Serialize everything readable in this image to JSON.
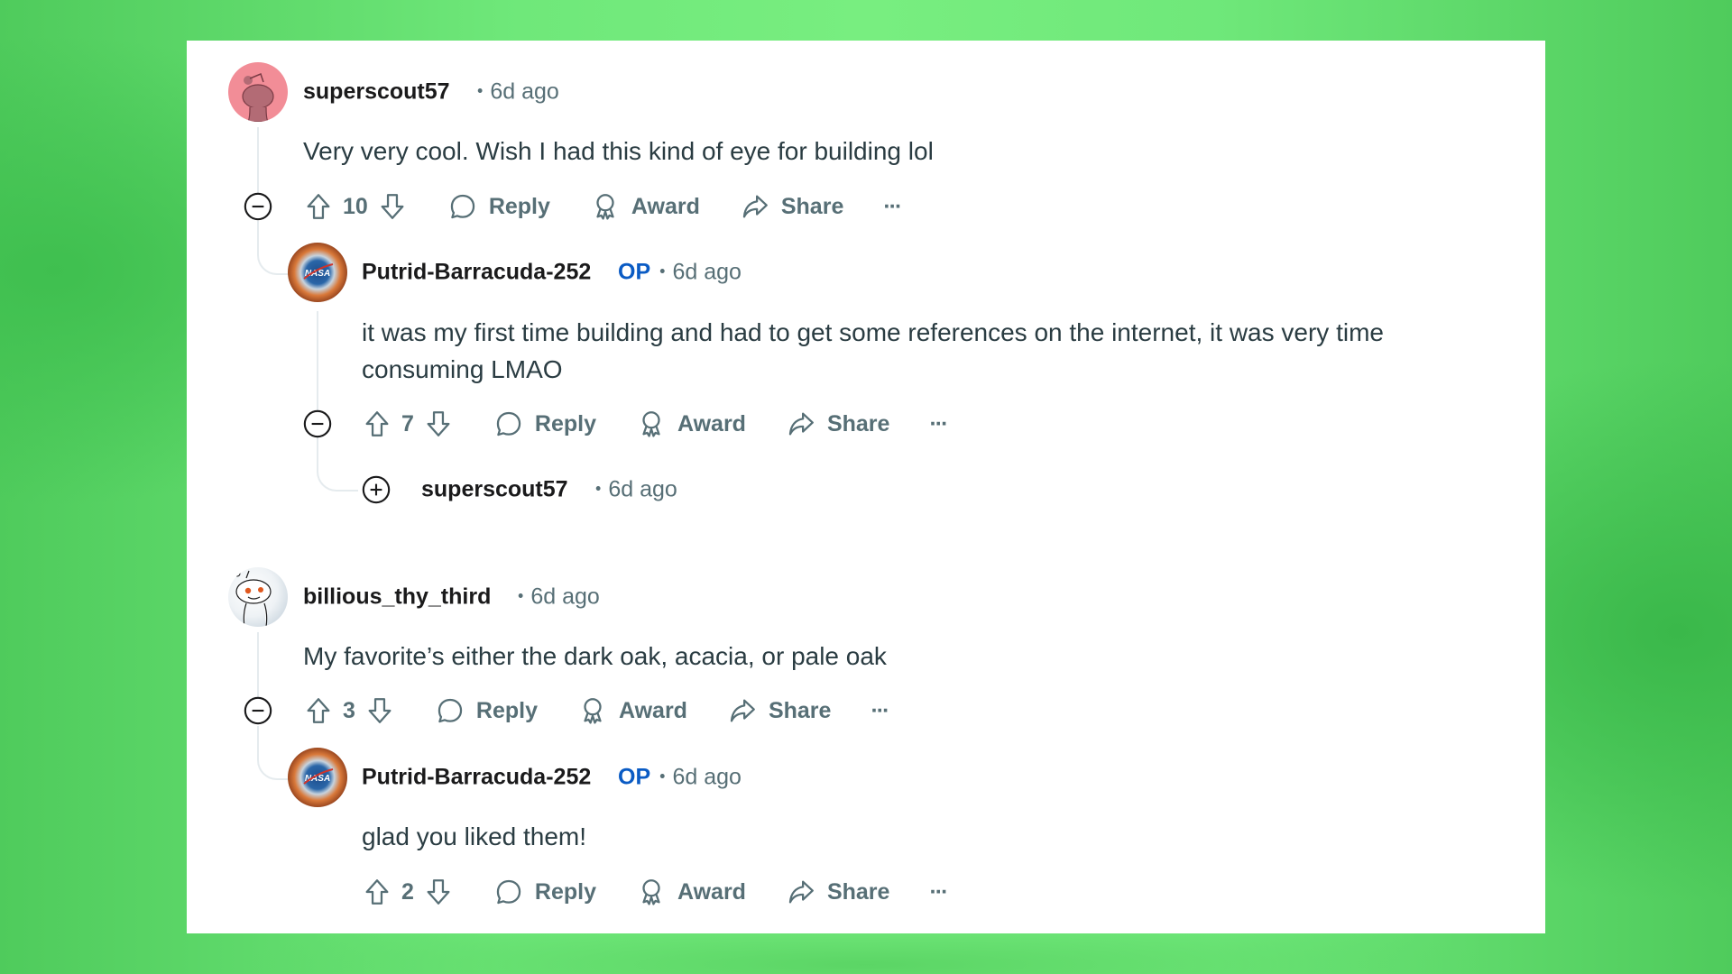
{
  "icons": {
    "upvote": "arrow-up-outline",
    "downvote": "arrow-down-outline",
    "reply": "speech-bubble",
    "award": "award-ribbon",
    "share": "share-arrow",
    "more": "ellipsis",
    "collapse": "minus-circle",
    "expand": "plus-circle"
  },
  "colors": {
    "background": "#6fe87a",
    "card": "#ffffff",
    "username": "#1a1a1b",
    "meta": "#576f76",
    "op_badge": "#0a5bc4",
    "body_text": "#2a3c42"
  },
  "actions_labels": {
    "reply": "Reply",
    "award": "Award",
    "share": "Share",
    "more": "···"
  },
  "comments": [
    {
      "username": "superscout57",
      "age": "6d ago",
      "body": [
        "Very very cool. Wish I had this kind of eye for building lol"
      ],
      "score": "10",
      "replies": [
        {
          "username": "Putrid-Barracuda-252",
          "op_badge": "OP",
          "age": "6d ago",
          "body": [
            "it was my first time building and had to get some references on the internet, it was very time",
            "consuming LMAO"
          ],
          "score": "7",
          "replies": [
            {
              "username": "superscout57",
              "age": "6d ago",
              "collapsed": true
            }
          ]
        }
      ]
    },
    {
      "username": "billious_thy_third",
      "age": "6d ago",
      "body": [
        "My favorite’s either the dark oak, acacia, or pale oak"
      ],
      "score": "3",
      "replies": [
        {
          "username": "Putrid-Barracuda-252",
          "op_badge": "OP",
          "age": "6d ago",
          "body": [
            "glad you liked them!"
          ],
          "score": "2"
        }
      ]
    }
  ],
  "separator": "•"
}
